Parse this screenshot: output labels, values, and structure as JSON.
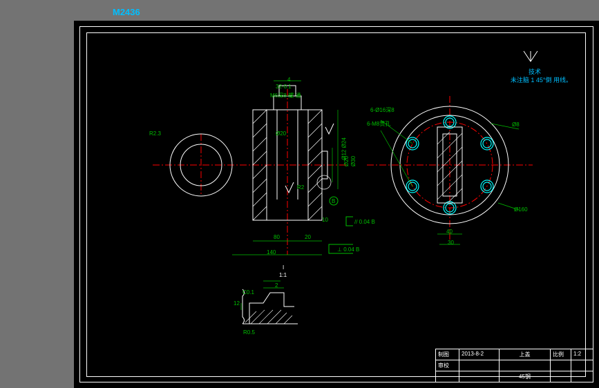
{
  "header": {
    "file_id": "M2436"
  },
  "notes": {
    "tech_req_label": "技术",
    "tech_req_text": "未注脑 1 45°倒 用线。"
  },
  "titleblock": {
    "r1c1": "制图",
    "r1c2": "2013-8-2",
    "r1c3": "上盖",
    "r1c4": "比例",
    "r1c5": "1:2",
    "r2c1": "审校",
    "r2c2": "",
    "r2c3": "",
    "r2c4": "",
    "r2c5": "",
    "r3c1": "",
    "r3c2": "",
    "r3c3": "45钢",
    "r3c4": "",
    "r3c5": ""
  },
  "dimensions": {
    "front": {
      "top_small": "4",
      "top_tol": "32-0.1",
      "callout": "M6深8-螺 通",
      "r3": "R2.3",
      "d20": "Ø20",
      "d12_24": "Ø12 Ø24",
      "d20_2": "Ø20",
      "d30": "Ø30",
      "h80": "80",
      "h20": "20",
      "h10": "10",
      "w140": "140",
      "r2": "R2",
      "gd1": "// 0.04 B",
      "gd2": "⊥ 0.04 B",
      "datum_b": "B"
    },
    "top": {
      "hole_callout": "6-Ø16深8",
      "thread_callout": "6-M8贯孔",
      "d8": "Ø8",
      "d160": "Ø160",
      "h40": "40",
      "w30": "30"
    },
    "detail": {
      "label": "I",
      "scale": "1:1",
      "c01": "C0.1",
      "h2": "2",
      "w12": "12",
      "r05": "R0.5"
    }
  }
}
